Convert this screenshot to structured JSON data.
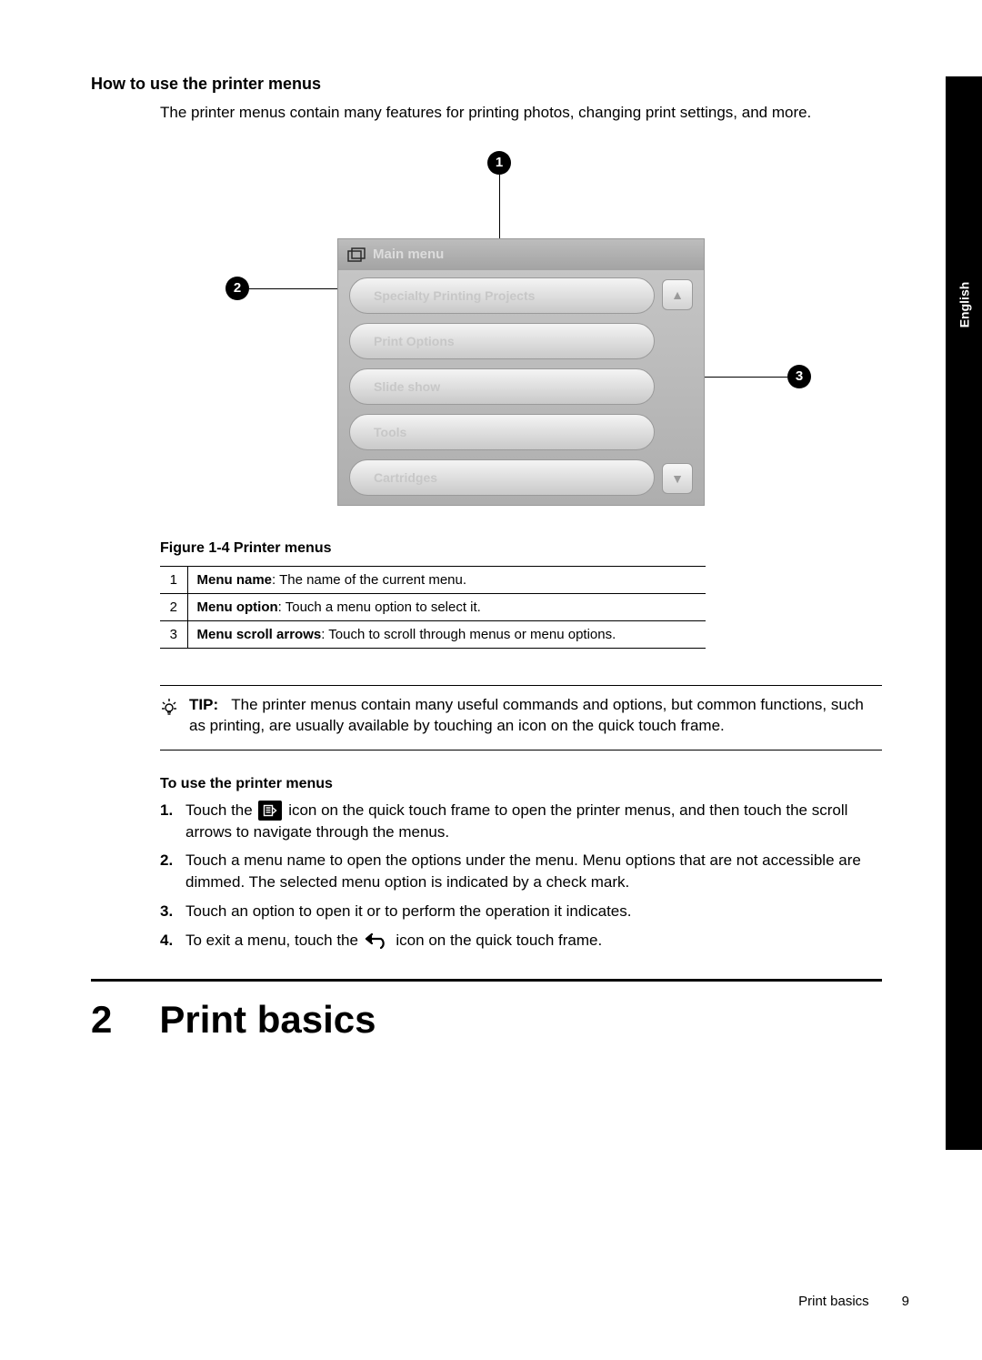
{
  "language_tab": "English",
  "heading": "How to use the printer menus",
  "intro": "The printer menus contain many features for printing photos, changing print settings, and more.",
  "callouts": {
    "c1": "1",
    "c2": "2",
    "c3": "3"
  },
  "screen": {
    "title": "Main menu",
    "items": [
      "Specialty Printing Projects",
      "Print Options",
      "Slide show",
      "Tools",
      "Cartridges"
    ],
    "scroll_up_glyph": "▲",
    "scroll_down_glyph": "▼"
  },
  "figure_caption": "Figure 1-4 Printer menus",
  "legend": [
    {
      "n": "1",
      "term": "Menu name",
      "desc": ": The name of the current menu."
    },
    {
      "n": "2",
      "term": "Menu option",
      "desc": ": Touch a menu option to select it."
    },
    {
      "n": "3",
      "term": "Menu scroll arrows",
      "desc": ": Touch to scroll through menus or menu options."
    }
  ],
  "tip": {
    "label": "TIP:",
    "text": "The printer menus contain many useful commands and options, but common functions, such as printing, are usually available by touching an icon on the quick touch frame."
  },
  "subhead": "To use the printer menus",
  "steps": {
    "s1_num": "1.",
    "s1_a": "Touch the ",
    "s1_b": " icon on the quick touch frame to open the printer menus, and then touch the scroll arrows to navigate through the menus.",
    "s2_num": "2.",
    "s2": "Touch a menu name to open the options under the menu. Menu options that are not accessible are dimmed. The selected menu option is indicated by a check mark.",
    "s3_num": "3.",
    "s3": "Touch an option to open it or to perform the operation it indicates.",
    "s4_num": "4.",
    "s4_a": "To exit a menu, touch the ",
    "s4_b": " icon on the quick touch frame."
  },
  "chapter": {
    "num": "2",
    "title": "Print basics"
  },
  "footer": {
    "section": "Print basics",
    "page": "9"
  }
}
